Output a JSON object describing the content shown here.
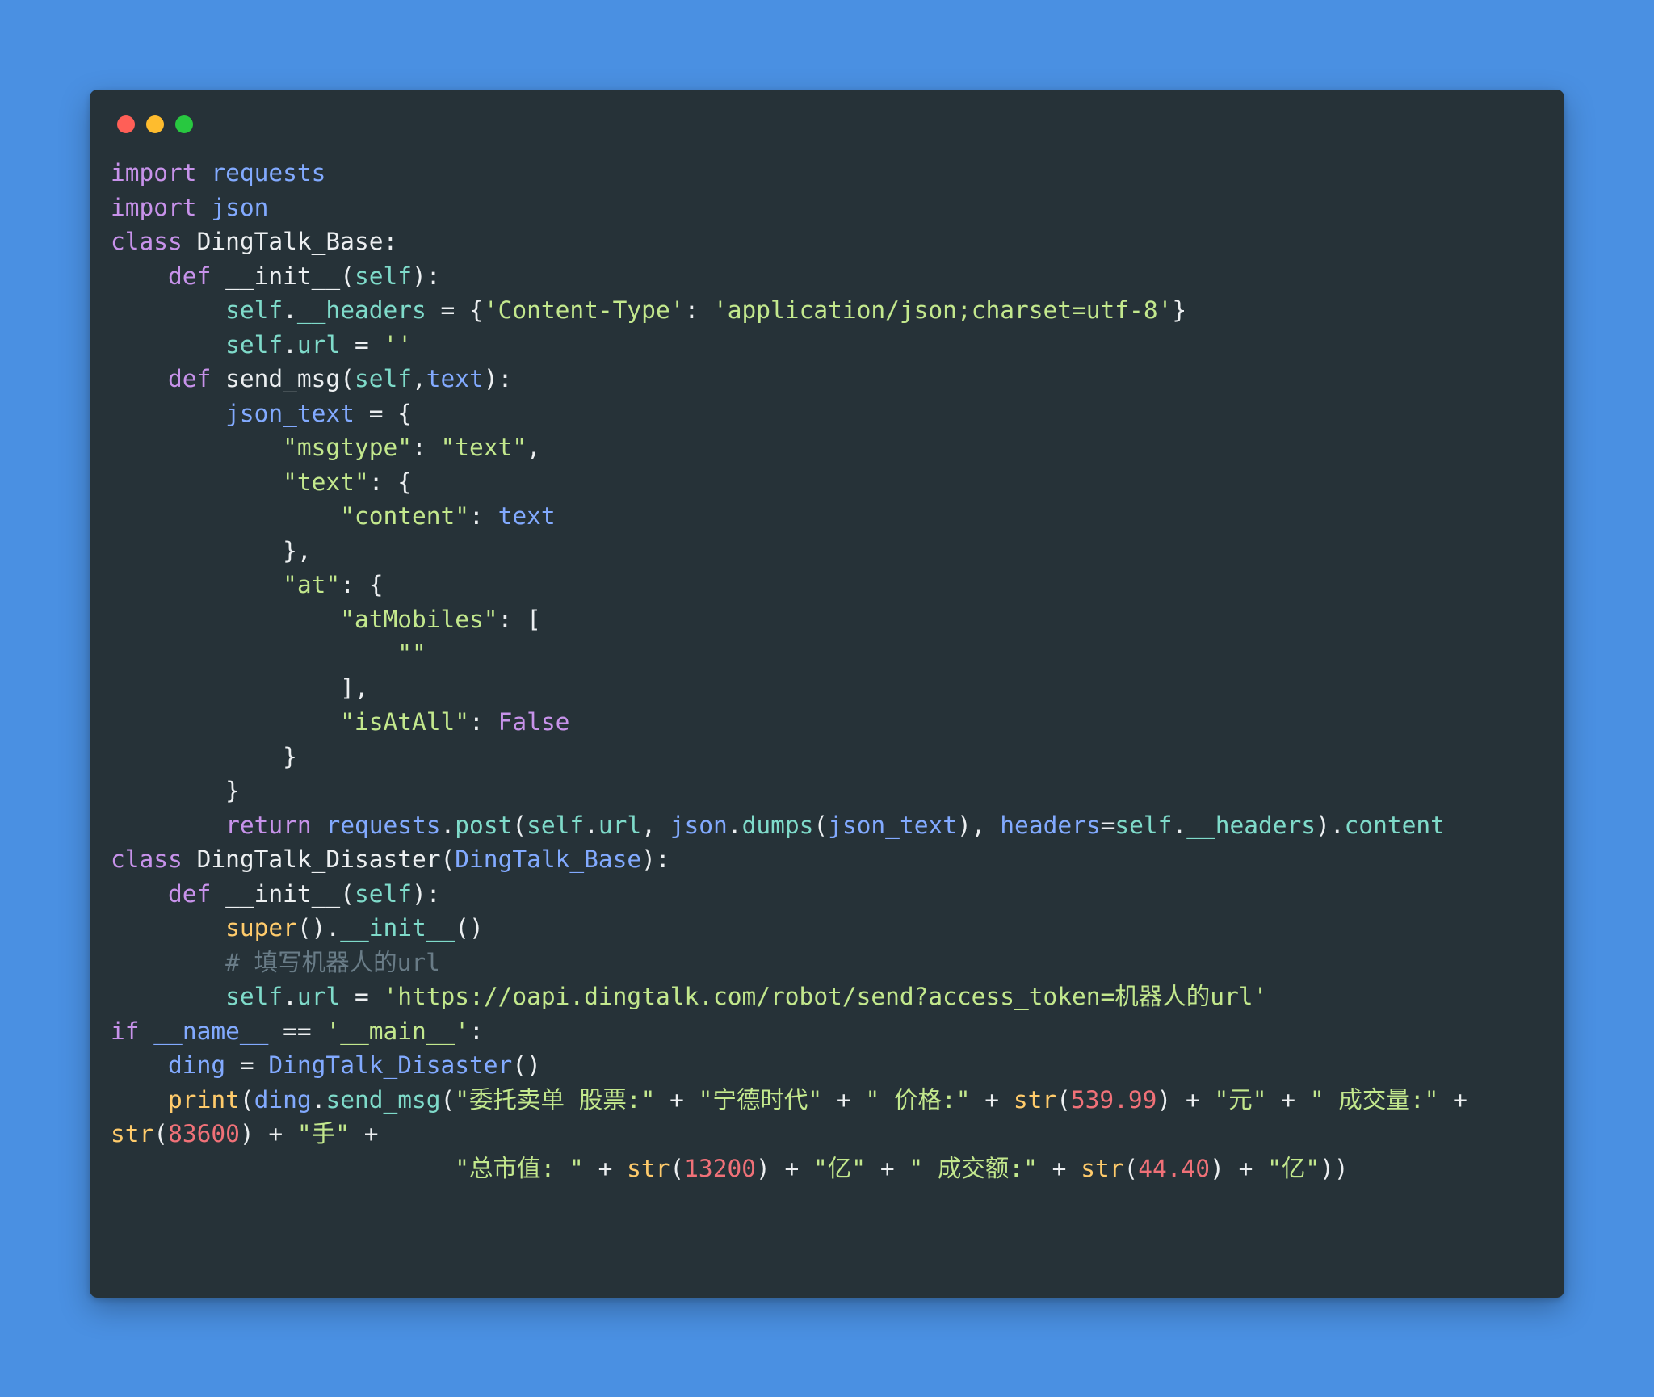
{
  "window": {
    "background_color": "#4a90e2",
    "editor_background": "#263238",
    "traffic_lights": [
      {
        "name": "close",
        "color": "#ff5f57"
      },
      {
        "name": "minimize",
        "color": "#febc2e"
      },
      {
        "name": "maximize",
        "color": "#28c840"
      }
    ]
  },
  "code": {
    "language": "python",
    "lines": [
      "import requests",
      "import json",
      "class DingTalk_Base:",
      "    def __init__(self):",
      "        self.__headers = {'Content-Type': 'application/json;charset=utf-8'}",
      "        self.url = ''",
      "    def send_msg(self,text):",
      "        json_text = {",
      "            \"msgtype\": \"text\",",
      "            \"text\": {",
      "                \"content\": text",
      "            },",
      "            \"at\": {",
      "                \"atMobiles\": [",
      "                    \"\"",
      "                ],",
      "                \"isAtAll\": False",
      "            }",
      "        }",
      "        return requests.post(self.url, json.dumps(json_text), headers=self.__headers).content",
      "class DingTalk_Disaster(DingTalk_Base):",
      "    def __init__(self):",
      "        super().__init__()",
      "        # 填写机器人的url",
      "        self.url = 'https://oapi.dingtalk.com/robot/send?access_token=机器人的url'",
      "if __name__ == '__main__':",
      "    ding = DingTalk_Disaster()",
      "    print(ding.send_msg(\"委托卖单 股票:\" + \"宁德时代\" + \" 价格:\" + str(539.99) + \"元\" + \" 成交量:\" + str(83600) + \"手\" +",
      "                        \"总市值: \" + str(13200) + \"亿\" + \" 成交额:\" + str(44.40) + \"亿\"))"
    ],
    "token_colors": {
      "keyword": "#c792ea",
      "string": "#c3e88d",
      "number": "#f07178",
      "builtin": "#ffcb6b",
      "module": "#82aaff",
      "attribute": "#7fdbca",
      "comment": "#697c87",
      "plain": "#eceff1"
    },
    "values": {
      "price": "539.99",
      "volume": "83600",
      "market_cap": "13200",
      "turnover": "44.40",
      "stock_name": "宁德时代",
      "order_type": "委托卖单",
      "robot_url": "https://oapi.dingtalk.com/robot/send?access_token=机器人的url",
      "content_type": "application/json;charset=utf-8"
    }
  }
}
